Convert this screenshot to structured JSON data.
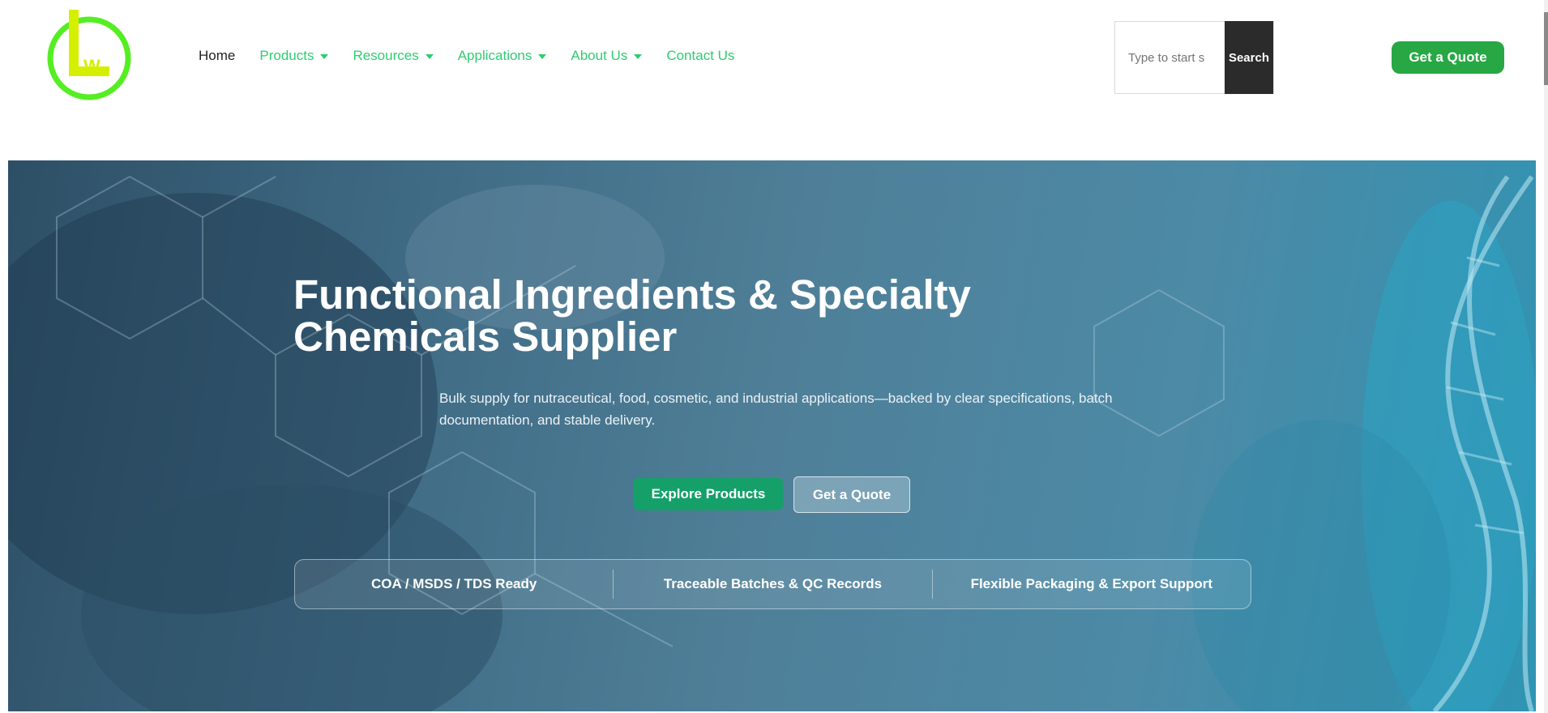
{
  "header": {
    "logo": {
      "icon": "lw-logo",
      "text": "LW",
      "colors": {
        "ring": "#55ee22",
        "letter": "#d4f000"
      }
    },
    "nav": [
      {
        "label": "Home",
        "dropdown": false
      },
      {
        "label": "Products",
        "dropdown": true
      },
      {
        "label": "Resources",
        "dropdown": true
      },
      {
        "label": "Applications",
        "dropdown": true
      },
      {
        "label": "About Us",
        "dropdown": true
      },
      {
        "label": "Contact Us",
        "dropdown": false
      }
    ],
    "search": {
      "placeholder": "Type to start s",
      "button_label": "Search"
    },
    "quote_button": "Get a Quote"
  },
  "hero": {
    "title": "Functional Ingredients & Specialty Chemicals Supplier",
    "subtitle": "Bulk supply for nutraceutical, food, cosmetic, and industrial applications—backed by clear specifications, batch documentation, and stable delivery.",
    "primary_button": "Explore Products",
    "secondary_button": "Get a Quote",
    "features": [
      "COA / MSDS / TDS Ready",
      "Traceable Batches & QC Records",
      "Flexible Packaging & Export Support"
    ]
  },
  "colors": {
    "nav_link": "#2ecc71",
    "quote_button": "#27a844",
    "explore_button": "#15a06a",
    "search_button": "#2b2b2b",
    "hero_background": "#4c7f99"
  }
}
